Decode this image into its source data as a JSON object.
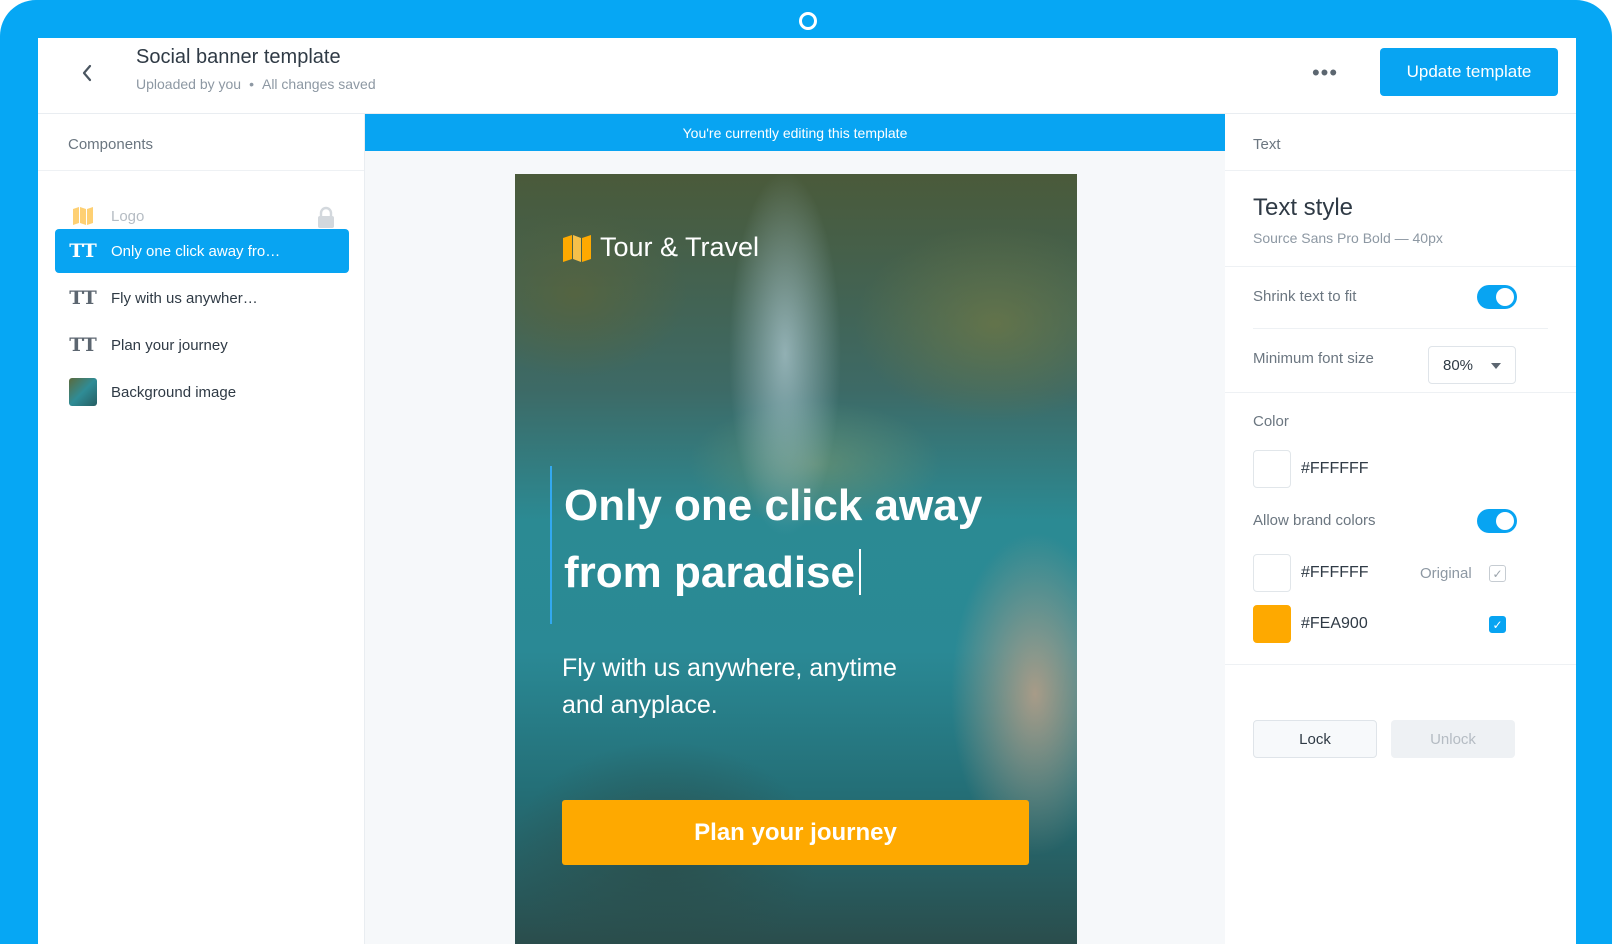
{
  "header": {
    "title": "Social banner template",
    "uploaded_by": "Uploaded by you",
    "separator": "•",
    "save_status": "All changes saved",
    "more_label": "•••",
    "update_label": "Update template"
  },
  "components": {
    "title": "Components",
    "items": [
      {
        "label": "Logo",
        "icon": "map-icon",
        "state": "locked"
      },
      {
        "label": "Only one click away fro…",
        "icon": "text-icon",
        "state": "active"
      },
      {
        "label": "Fly with us anywher…",
        "icon": "text-icon",
        "state": "normal"
      },
      {
        "label": "Plan your journey",
        "icon": "text-icon",
        "state": "normal"
      },
      {
        "label": "Background image",
        "icon": "image-thumbnail",
        "state": "normal"
      }
    ],
    "text_icon_glyph": "TT"
  },
  "canvas": {
    "editing_notice": "You're currently editing this template",
    "brand_name": "Tour & Travel",
    "headline": "Only one click away from paradise",
    "subtext": "Fly with us anywhere, anytime and anyplace.",
    "cta": "Plan your journey"
  },
  "text_panel": {
    "section_title": "Text",
    "style_title": "Text style",
    "style_detail": "Source Sans Pro Bold — 40px",
    "shrink_label": "Shrink text to fit",
    "shrink_enabled": true,
    "min_font_label": "Minimum font size",
    "min_font_value": "80%",
    "color_label": "Color",
    "color_hex": "#FFFFFF",
    "brand_colors_label": "Allow brand colors",
    "brand_colors_enabled": true,
    "brand_colors": [
      {
        "hex": "#FFFFFF",
        "tag": "Original",
        "checked": true
      },
      {
        "hex": "#FEA900",
        "tag": "",
        "checked": true
      }
    ],
    "lock_label": "Lock",
    "unlock_label": "Unlock"
  },
  "colors": {
    "accent": "#08a4f2",
    "device_frame": "#06a7f4",
    "cta": "#fea900"
  }
}
